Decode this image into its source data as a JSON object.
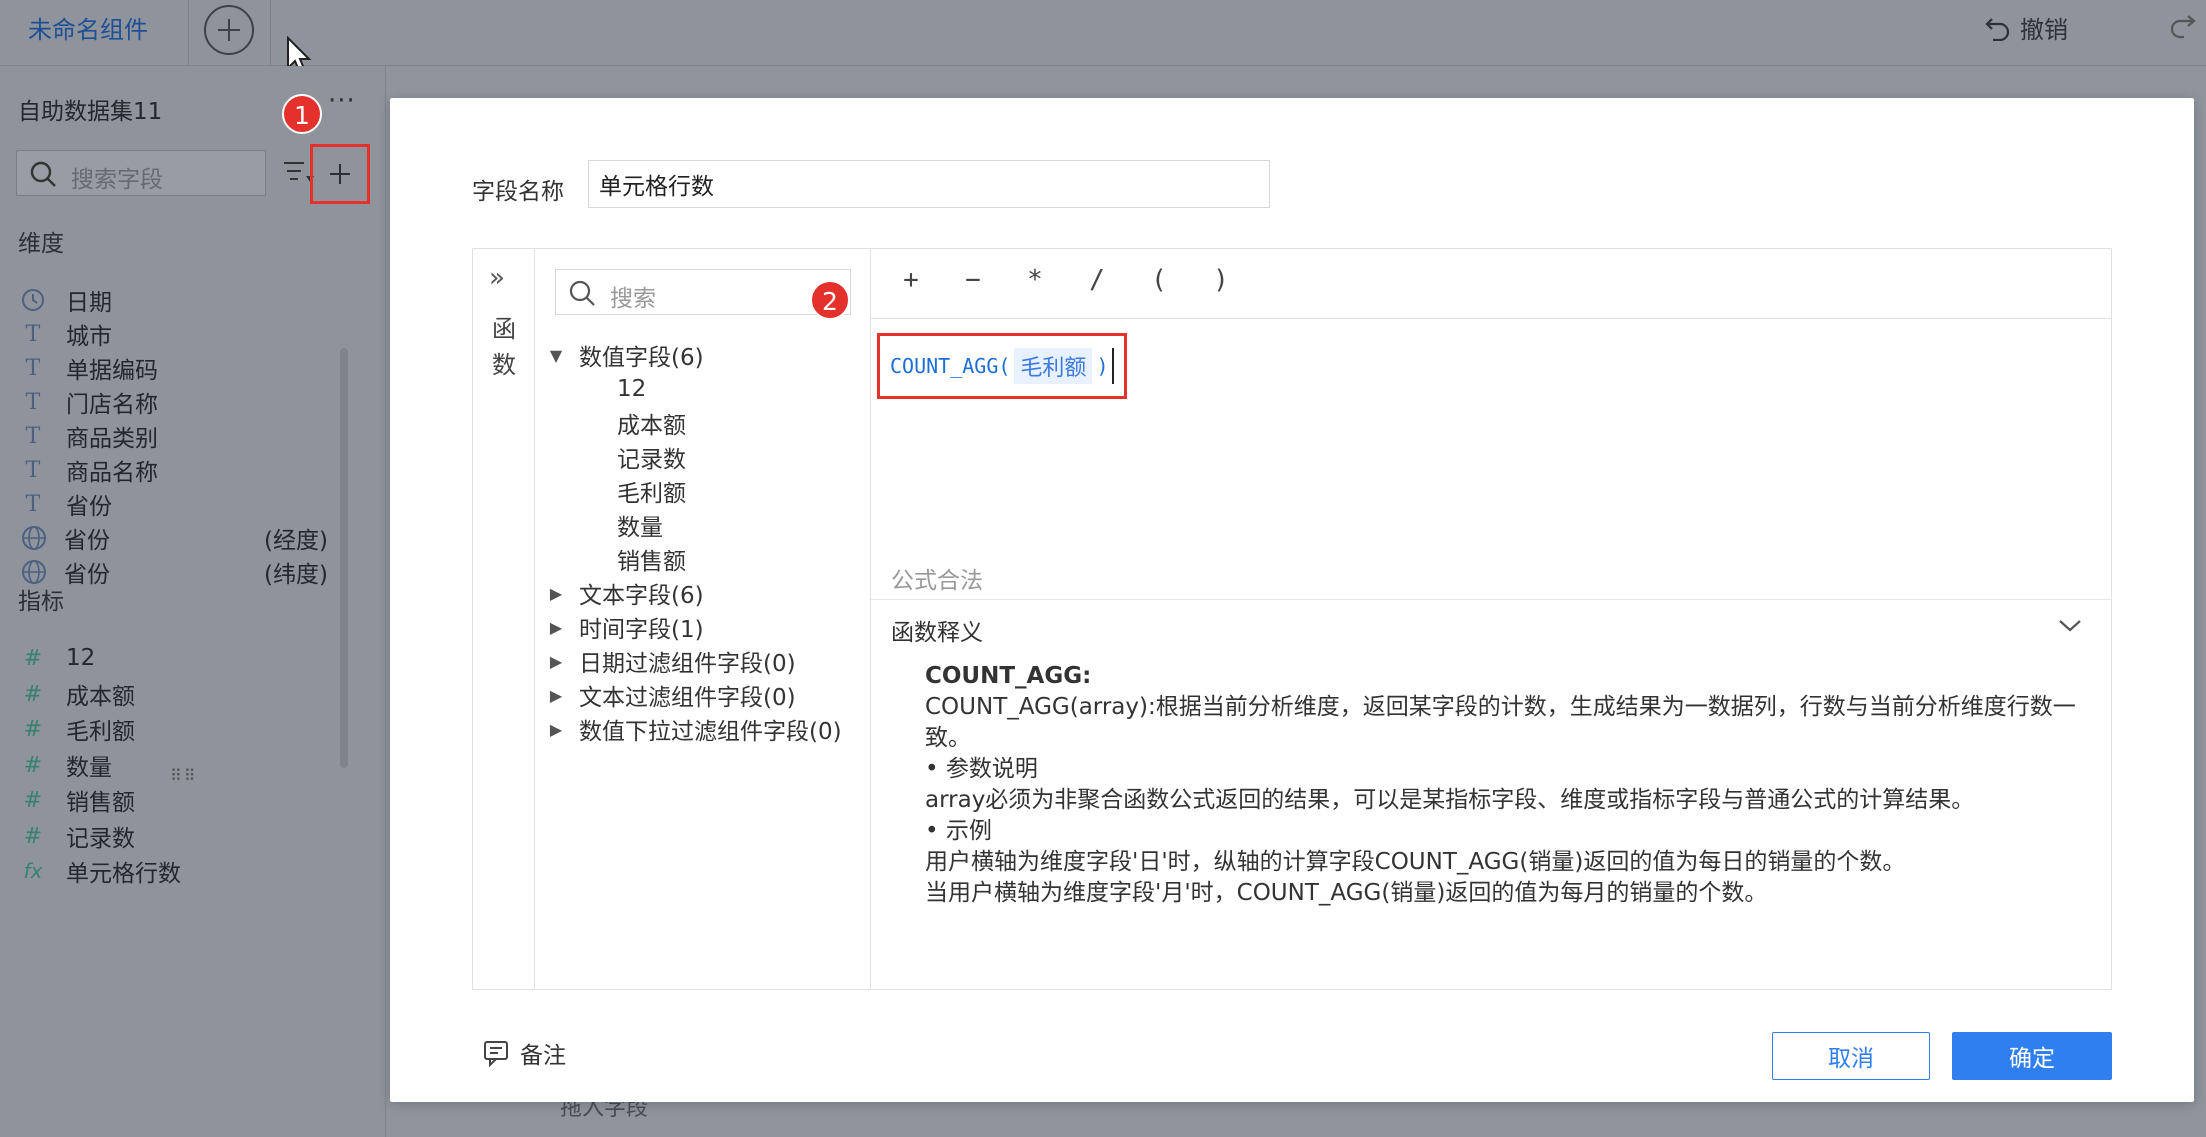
{
  "header": {
    "tab_name": "未命名组件",
    "undo_label": "撤销"
  },
  "sidebar": {
    "dataset_title": "自助数据集11",
    "more_label": "···",
    "search_placeholder": "搜索字段",
    "step1_badge": "1",
    "dimension_title": "维度",
    "dimensions": [
      {
        "icon": "clock-icon",
        "label": "日期",
        "extra": ""
      },
      {
        "icon": "text-type-icon",
        "label": "城市",
        "extra": ""
      },
      {
        "icon": "text-type-icon",
        "label": "单据编码",
        "extra": ""
      },
      {
        "icon": "text-type-icon",
        "label": "门店名称",
        "extra": ""
      },
      {
        "icon": "text-type-icon",
        "label": "商品类别",
        "extra": ""
      },
      {
        "icon": "text-type-icon",
        "label": "商品名称",
        "extra": ""
      },
      {
        "icon": "text-type-icon",
        "label": "省份",
        "extra": ""
      },
      {
        "icon": "globe-icon",
        "label": "省份",
        "extra": "(经度)"
      },
      {
        "icon": "globe-icon",
        "label": "省份",
        "extra": "(纬度)"
      }
    ],
    "measure_title": "指标",
    "measures": [
      {
        "icon": "hash-icon",
        "label": "12"
      },
      {
        "icon": "hash-icon",
        "label": "成本额"
      },
      {
        "icon": "hash-icon",
        "label": "毛利额"
      },
      {
        "icon": "hash-icon",
        "label": "数量"
      },
      {
        "icon": "hash-icon",
        "label": "销售额"
      },
      {
        "icon": "hash-icon",
        "label": "记录数"
      },
      {
        "icon": "formula-icon",
        "label": "单元格行数"
      }
    ],
    "bottom_hint": "拖入字段"
  },
  "modal": {
    "field_name_label": "字段名称",
    "field_name_value": "单元格行数",
    "fn_panel_label_1": "函",
    "fn_panel_label_2": "数",
    "tree_search_placeholder": "搜索",
    "step2_badge": "2",
    "tree": {
      "numeric_group": "数值字段(6)",
      "numeric_fields": [
        "12",
        "成本额",
        "记录数",
        "毛利额",
        "数量",
        "销售额"
      ],
      "collapsed_groups": [
        "文本字段(6)",
        "时间字段(1)",
        "日期过滤组件字段(0)",
        "文本过滤组件字段(0)",
        "数值下拉过滤组件字段(0)"
      ]
    },
    "operators": [
      "+",
      "−",
      "*",
      "/",
      "(",
      ")"
    ],
    "formula": {
      "func": "COUNT_AGG(",
      "arg": "毛利额",
      "close": ")"
    },
    "valid_text": "公式合法",
    "help_title": "函数释义",
    "help": {
      "name": "COUNT_AGG:",
      "desc": "COUNT_AGG(array):根据当前分析维度，返回某字段的计数，生成结果为一数据列，行数与当前分析维度行数一致。",
      "param_head": "• 参数说明",
      "param_desc": "array必须为非聚合函数公式返回的结果，可以是某指标字段、维度或指标字段与普通公式的计算结果。",
      "example_head": "• 示例",
      "example_1": "用户横轴为维度字段'日'时，纵轴的计算字段COUNT_AGG(销量)返回的值为每日的销量的个数。",
      "example_2": "当用户横轴为维度字段'月'时，COUNT_AGG(销量)返回的值为每月的销量的个数。"
    },
    "note_label": "备注",
    "cancel_label": "取消",
    "ok_label": "确定"
  }
}
